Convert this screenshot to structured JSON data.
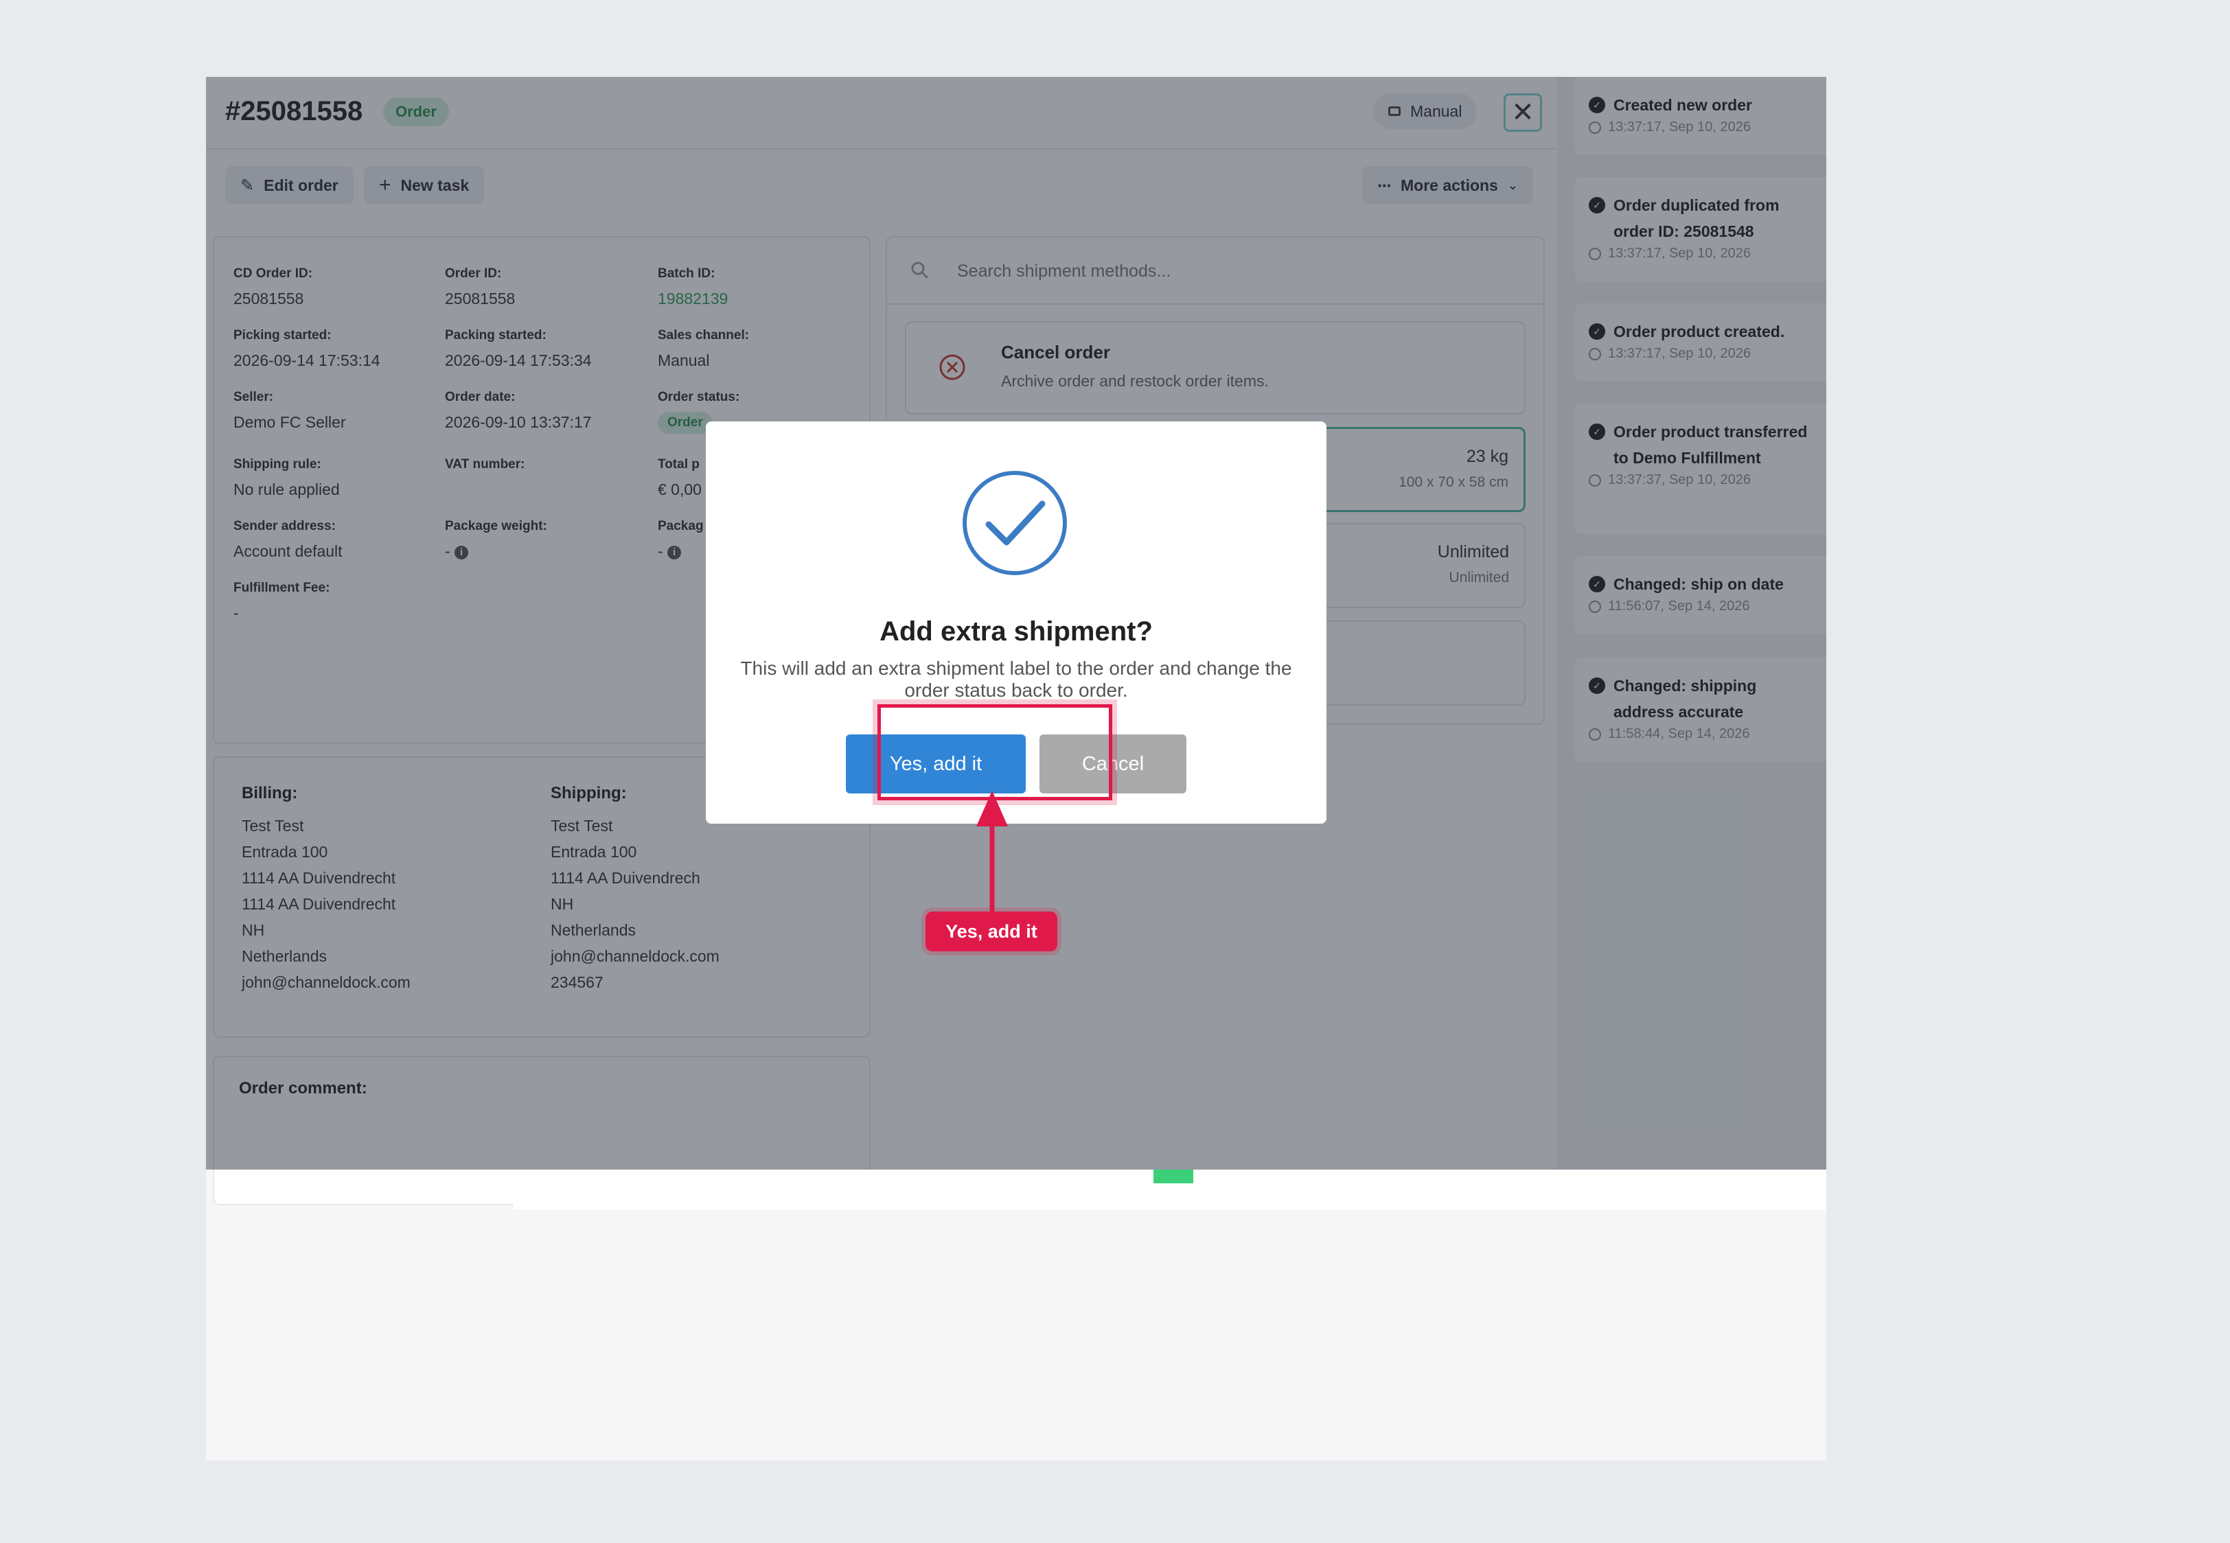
{
  "order": {
    "number": "#25081558",
    "status_badge": "Order",
    "manual_label": "Manual",
    "close_glyph": "✕"
  },
  "toolbar": {
    "edit_order": "Edit order",
    "new_task": "New task",
    "more_actions": "More actions"
  },
  "details": {
    "cd_order_id_label": "CD Order ID:",
    "cd_order_id": "25081558",
    "order_id_label": "Order ID:",
    "order_id": "25081558",
    "batch_id_label": "Batch ID:",
    "batch_id": "19882139",
    "picking_started_label": "Picking started:",
    "picking_started": "2026-09-14 17:53:14",
    "packing_started_label": "Packing started:",
    "packing_started": "2026-09-14 17:53:34",
    "sales_channel_label": "Sales channel:",
    "sales_channel": "Manual",
    "seller_label": "Seller:",
    "seller": "Demo FC Seller",
    "order_date_label": "Order date:",
    "order_date": "2026-09-10 13:37:17",
    "order_status_label": "Order status:",
    "order_status": "Order",
    "shipping_rule_label": "Shipping rule:",
    "shipping_rule": "No rule applied",
    "vat_number_label": "VAT number:",
    "total_label": "Total p",
    "total": "€ 0,00",
    "sender_address_label": "Sender address:",
    "sender_address": "Account default",
    "package_weight_label": "Package weight:",
    "package_weight": "-",
    "package_label": "Packag",
    "package_value": "-",
    "fulfillment_fee_label": "Fulfillment Fee:",
    "fulfillment_fee": "-"
  },
  "billing": {
    "title": "Billing:",
    "lines": [
      "Test Test",
      "Entrada 100",
      "1114 AA Duivendrecht",
      "1114 AA Duivendrecht",
      "NH",
      "Netherlands"
    ],
    "email": "john@channeldock.com"
  },
  "shipping": {
    "title": "Shipping:",
    "lines": [
      "Test Test",
      "Entrada 100",
      "1114 AA Duivendrech",
      "NH",
      "Netherlands"
    ],
    "email": "john@channeldock.com",
    "phone": "234567"
  },
  "comment": {
    "title": "Order comment:"
  },
  "shipment_methods": {
    "search_placeholder": "Search shipment methods...",
    "cancel_title": "Cancel order",
    "cancel_desc": "Archive order and restock order items.",
    "m1_weight": "23 kg",
    "m1_dims": "100 x 70 x 58 cm",
    "m2_primary": "Unlimited",
    "m2_secondary": "Unlimited"
  },
  "activity": [
    {
      "title": "Created new order",
      "time": "13:37:17, Sep 10, 2026"
    },
    {
      "title": "Order duplicated from order ID: 25081548",
      "time": "13:37:17, Sep 10, 2026"
    },
    {
      "title": "Order product created.",
      "time": "13:37:17, Sep 10, 2026"
    },
    {
      "title": "Order product transferred to Demo Fulfillment",
      "time": "13:37:37, Sep 10, 2026"
    },
    {
      "title": "Changed: ship on date",
      "time": "11:56:07, Sep 14, 2026"
    },
    {
      "title": "Changed: shipping address accurate",
      "time": "11:58:44, Sep 14, 2026"
    }
  ],
  "modal": {
    "title": "Add extra shipment?",
    "text": "This will add an extra shipment label to the order and change the order status back to order.",
    "confirm": "Yes, add it",
    "cancel": "Cancel"
  },
  "annotation": {
    "label": "Yes, add it"
  },
  "colors": {
    "accent_green": "#2e9a5c",
    "confirm_blue": "#3085d6",
    "cancel_gray": "#aaaaaa",
    "annotation_red": "#e0194b"
  }
}
